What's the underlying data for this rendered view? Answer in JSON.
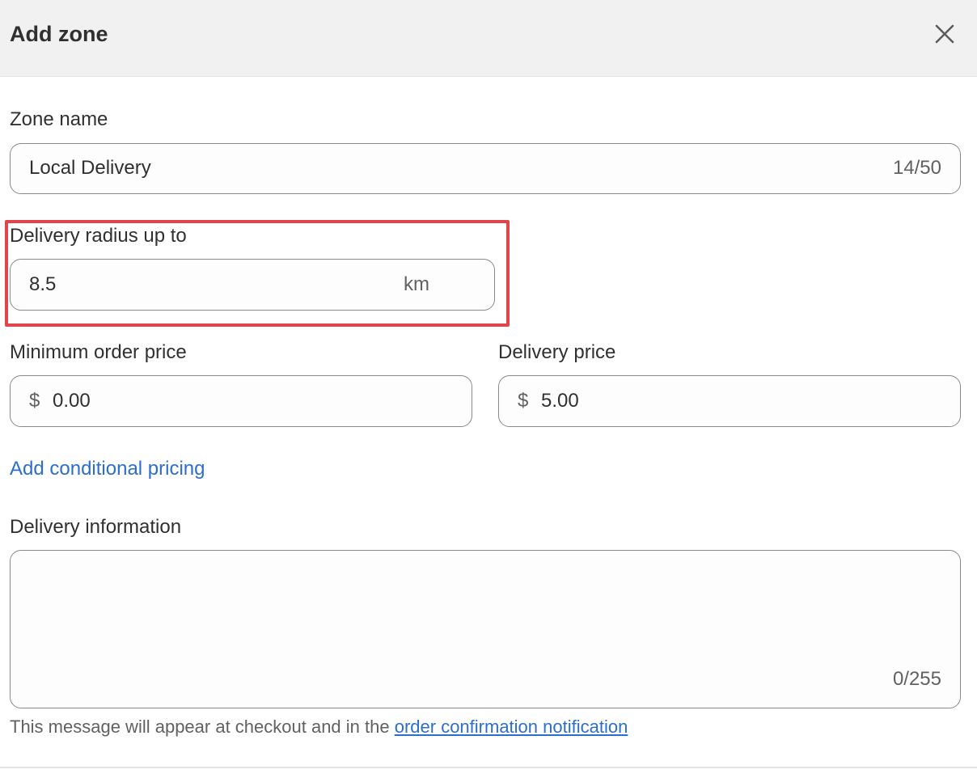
{
  "header": {
    "title": "Add zone",
    "close_icon": "close-icon"
  },
  "zone_name": {
    "label": "Zone name",
    "value": "Local Delivery",
    "counter": "14/50"
  },
  "delivery_radius": {
    "label": "Delivery radius up to",
    "value": "8.5",
    "unit": "km",
    "highlight_color": "#e0454b"
  },
  "minimum_order_price": {
    "label": "Minimum order price",
    "prefix": "$",
    "value": "0.00"
  },
  "delivery_price": {
    "label": "Delivery price",
    "prefix": "$",
    "value": "5.00"
  },
  "conditional_pricing": {
    "link_label": "Add conditional pricing"
  },
  "delivery_information": {
    "label": "Delivery information",
    "value": "",
    "counter": "0/255",
    "help_text": "This message will appear at checkout and in the ",
    "help_link": "order confirmation notification"
  },
  "colors": {
    "link": "#2c6ecb",
    "header_bg": "#f1f1f1",
    "border": "#8a8a8a"
  }
}
